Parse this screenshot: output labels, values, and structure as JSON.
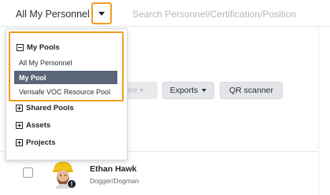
{
  "header": {
    "pool_title": "All My Personnel",
    "search_placeholder": "Search Personnel/Certification/Position"
  },
  "toolbar": {
    "more_label": "ore ▾",
    "exports_label": "Exports",
    "qr_label": "QR scanner"
  },
  "dropdown": {
    "my_pools": {
      "label": "My Pools",
      "items": [
        {
          "label": "All My Personnel",
          "selected": false
        },
        {
          "label": "My Pool",
          "selected": true
        },
        {
          "label": "Verisafe VOC Resource Pool",
          "selected": false
        }
      ]
    },
    "groups": [
      {
        "label": "Shared Pools"
      },
      {
        "label": "Assets"
      },
      {
        "label": "Projects"
      }
    ]
  },
  "personnel": [
    {
      "name": "Ethan Hawk",
      "role": "Dogger/Dogman",
      "alert": "!"
    }
  ],
  "colors": {
    "highlight_orange": "#f39c1e",
    "selected_bg": "#5a6577",
    "hardhat_yellow": "#f5c518"
  }
}
